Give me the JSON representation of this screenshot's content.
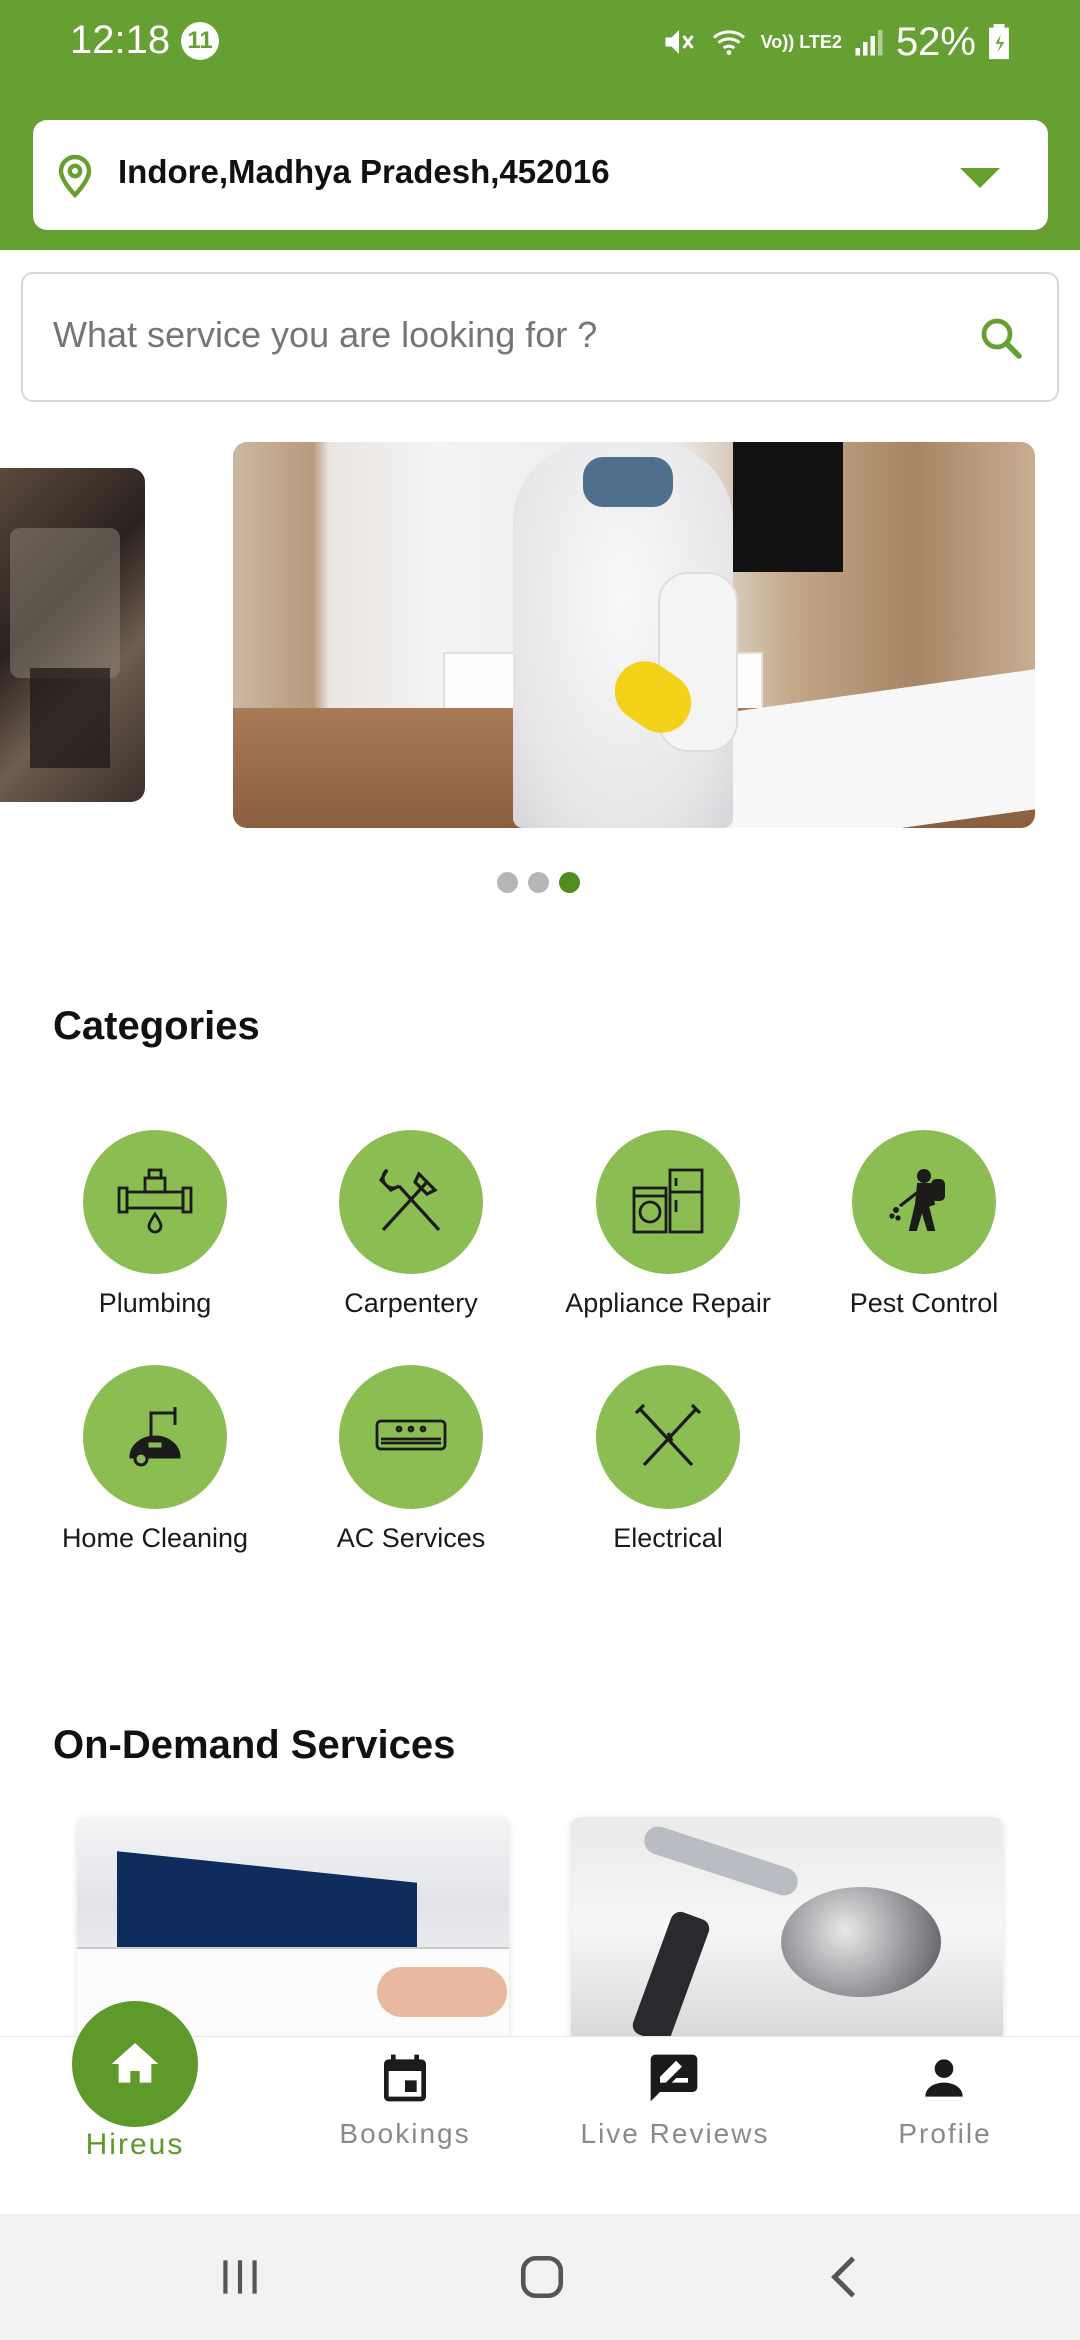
{
  "status_bar": {
    "time": "12:18",
    "notification_count": "11",
    "network": "Vo)) LTE2",
    "battery": "52%"
  },
  "location": {
    "value": "Indore,Madhya Pradesh,452016"
  },
  "search": {
    "placeholder": "What service you are looking for ?"
  },
  "carousel": {
    "page_count": 3,
    "active_index": 2
  },
  "categories": {
    "title": "Categories",
    "items": [
      {
        "label": "Plumbing",
        "icon": "plumbing-icon"
      },
      {
        "label": "Carpentery",
        "icon": "tools-icon"
      },
      {
        "label": "Appliance Repair",
        "icon": "appliance-icon"
      },
      {
        "label": "Pest Control",
        "icon": "pest-control-icon"
      },
      {
        "label": "Home Cleaning",
        "icon": "vacuum-icon"
      },
      {
        "label": "AC Services",
        "icon": "air-conditioner-icon"
      },
      {
        "label": "Electrical",
        "icon": "pliers-icon"
      }
    ]
  },
  "on_demand": {
    "title": "On-Demand Services"
  },
  "bottom_nav": {
    "items": [
      {
        "label": "Hireus",
        "icon": "home-icon",
        "active": true
      },
      {
        "label": "Bookings",
        "icon": "calendar-icon",
        "active": false
      },
      {
        "label": "Live Reviews",
        "icon": "review-icon",
        "active": false
      },
      {
        "label": "Profile",
        "icon": "person-icon",
        "active": false
      }
    ]
  },
  "colors": {
    "brand_green": "#66a033",
    "category_circle": "#8cbd52",
    "active_dot": "#4e8f1e"
  }
}
